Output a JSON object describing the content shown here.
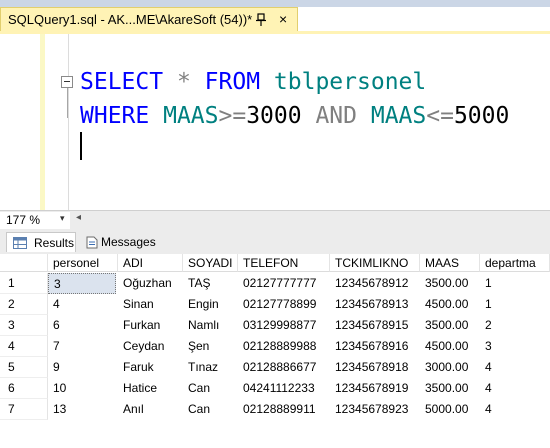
{
  "tab": {
    "title": "SQLQuery1.sql - AK...ME\\AkareSoft (54))*",
    "close": "×",
    "pin_icon": "pin-icon"
  },
  "editor": {
    "line1": {
      "kw1": "SELECT",
      "star": "*",
      "kw2": "FROM",
      "table": "tblpersonel"
    },
    "line2": {
      "kw1": "WHERE",
      "col1": "MAAS",
      "op1": ">=",
      "v1": "3000",
      "kw2": "AND",
      "col2": "MAAS",
      "op2": "<=",
      "v2": "5000"
    }
  },
  "status": {
    "zoom": "177 %",
    "zoom_arrow": "▾",
    "scroll_left": "◂"
  },
  "result_tabs": {
    "results": "Results",
    "messages": "Messages"
  },
  "grid": {
    "columns": [
      "personel",
      "ADI",
      "SOYADI",
      "TELEFON",
      "TCKIMLIKNO",
      "MAAS",
      "departma"
    ],
    "rows": [
      {
        "n": "1",
        "cells": [
          "3",
          "Oğuzhan",
          "TAŞ",
          "02127777777",
          "12345678912",
          "3500.00",
          "1"
        ]
      },
      {
        "n": "2",
        "cells": [
          "4",
          "Sinan",
          "Engin",
          "02127778899",
          "12345678913",
          "4500.00",
          "1"
        ]
      },
      {
        "n": "3",
        "cells": [
          "6",
          "Furkan",
          "Namlı",
          "03129998877",
          "12345678915",
          "3500.00",
          "2"
        ]
      },
      {
        "n": "4",
        "cells": [
          "7",
          "Ceydan",
          "Şen",
          "02128889988",
          "12345678916",
          "4500.00",
          "3"
        ]
      },
      {
        "n": "5",
        "cells": [
          "9",
          "Faruk",
          "Tınaz",
          "02128886677",
          "12345678918",
          "3000.00",
          "4"
        ]
      },
      {
        "n": "6",
        "cells": [
          "10",
          "Hatice",
          "Can",
          "04241112233",
          "12345678919",
          "3500.00",
          "4"
        ]
      },
      {
        "n": "7",
        "cells": [
          "13",
          "Anıl",
          "Can",
          "02128889911",
          "12345678923",
          "5000.00",
          "4"
        ]
      }
    ]
  },
  "colors": {
    "keyword": "#0000ff",
    "identifier": "#008080",
    "operator": "#808080",
    "tab_active": "#fff3b5"
  }
}
